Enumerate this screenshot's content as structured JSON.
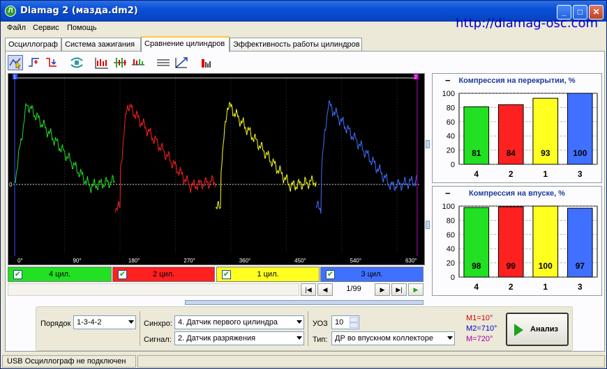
{
  "window": {
    "title": "Diamag 2 (мазда.dm2)",
    "url": "http://diamag-osc.com"
  },
  "menu": [
    "Файл",
    "Сервис",
    "Помощь"
  ],
  "tabs": [
    "Осциллограф",
    "Система зажигания",
    "Сравнение цилиндров",
    "Эффективность работы цилиндров"
  ],
  "active_tab": 2,
  "toolbar_icons": [
    "cursor-mode-icon",
    "marker-add-icon",
    "marker-remove-icon",
    "sync-icon",
    "cylinders-split-icon",
    "cylinders-overlay-icon",
    "cylinders-compare-icon",
    "grid-lines-icon",
    "scale-icon",
    "bar-chart-icon"
  ],
  "scope": {
    "marker_left": "1",
    "marker_right": "2",
    "zero_label": "0",
    "x_ticks": [
      "0°",
      "90°",
      "180°",
      "270°",
      "360°",
      "450°",
      "540°",
      "630°"
    ]
  },
  "cylinders": [
    {
      "label": "4 цил.",
      "color": "#22e022"
    },
    {
      "label": "2 цил.",
      "color": "#ff2020"
    },
    {
      "label": "1 цил.",
      "color": "#ffff20"
    },
    {
      "label": "3 цил.",
      "color": "#4070ff"
    }
  ],
  "navigation": {
    "page": "1/99"
  },
  "charts": [
    {
      "title": "Компрессия на перекрытии, %",
      "categories": [
        "4",
        "2",
        "1",
        "3"
      ],
      "values": [
        81,
        84,
        93,
        100
      ],
      "colors": [
        "#22e022",
        "#ff2020",
        "#ffff20",
        "#4070ff"
      ],
      "y_ticks": [
        "100",
        "80",
        "60",
        "40",
        "20",
        "0"
      ],
      "ylim": [
        0,
        100
      ]
    },
    {
      "title": "Компрессия на впуске, %",
      "categories": [
        "4",
        "2",
        "1",
        "3"
      ],
      "values": [
        98,
        99,
        100,
        97
      ],
      "colors": [
        "#22e022",
        "#ff2020",
        "#ffff20",
        "#4070ff"
      ],
      "y_ticks": [
        "100",
        "80",
        "60",
        "40",
        "20",
        "0"
      ],
      "ylim": [
        0,
        100
      ]
    }
  ],
  "chart_data": [
    {
      "type": "bar",
      "title": "Компрессия на перекрытии, %",
      "categories": [
        "4",
        "2",
        "1",
        "3"
      ],
      "values": [
        81,
        84,
        93,
        100
      ],
      "ylim": [
        0,
        100
      ]
    },
    {
      "type": "bar",
      "title": "Компрессия на впуске, %",
      "categories": [
        "4",
        "2",
        "1",
        "3"
      ],
      "values": [
        98,
        99,
        100,
        97
      ],
      "ylim": [
        0,
        100
      ]
    }
  ],
  "controls": {
    "order_label": "Порядок",
    "order_value": "1-3-4-2",
    "sync_label": "Синхро:",
    "sync_value": "4.  Датчик первого цилиндра",
    "signal_label": "Сигнал:",
    "signal_value": "2.  Датчик разряжения",
    "uoz_label": "УОЗ",
    "uoz_value": "10",
    "type_label": "Тип:",
    "type_value": "ДР во впускном коллекторе"
  },
  "markers": {
    "m1": "M1=10°",
    "m2": "M2=710°",
    "m": "M=720°",
    "m1_color": "#d00000",
    "m2_color": "#0000c0",
    "m_color": "#a000a0"
  },
  "analyze_label": "Анализ",
  "status": "USB Осциллограф не подключен"
}
